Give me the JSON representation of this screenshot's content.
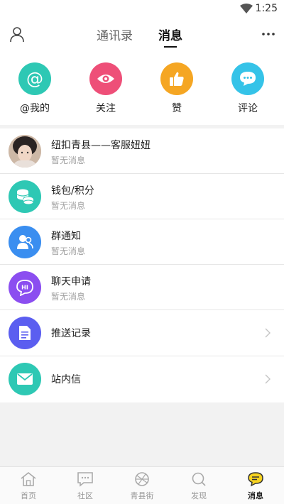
{
  "status_bar": {
    "time": "1:25"
  },
  "header": {
    "tabs": [
      {
        "label": "通讯录",
        "active": false
      },
      {
        "label": "消息",
        "active": true
      }
    ]
  },
  "quick_actions": [
    {
      "label": "@我的",
      "icon": "at-icon",
      "color": "#2ec8b4"
    },
    {
      "label": "关注",
      "icon": "eye-icon",
      "color": "#ee4f78"
    },
    {
      "label": "赞",
      "icon": "thumbs-up-icon",
      "color": "#f5a623"
    },
    {
      "label": "评论",
      "icon": "comment-icon",
      "color": "#35c3e8"
    }
  ],
  "messages": [
    {
      "title": "纽扣青县——客服妞妞",
      "subtitle": "暂无消息",
      "icon": "avatar-photo"
    },
    {
      "title": "钱包/积分",
      "subtitle": "暂无消息",
      "icon": "coins-icon",
      "color": "#2ec8b4"
    },
    {
      "title": "群通知",
      "subtitle": "暂无消息",
      "icon": "group-icon",
      "color": "#3a8ef0"
    },
    {
      "title": "聊天申请",
      "subtitle": "暂无消息",
      "icon": "chat-hi-icon",
      "color": "#8b4ef0"
    },
    {
      "title": "推送记录",
      "icon": "document-icon",
      "color": "#5b5ef0"
    },
    {
      "title": "站内信",
      "icon": "mail-icon",
      "color": "#2ec8b4"
    }
  ],
  "tab_bar": [
    {
      "label": "首页",
      "icon": "home-icon",
      "active": false
    },
    {
      "label": "社区",
      "icon": "community-icon",
      "active": false
    },
    {
      "label": "青县街",
      "icon": "street-icon",
      "active": false
    },
    {
      "label": "发现",
      "icon": "discover-icon",
      "active": false
    },
    {
      "label": "消息",
      "icon": "message-icon",
      "active": true
    }
  ]
}
